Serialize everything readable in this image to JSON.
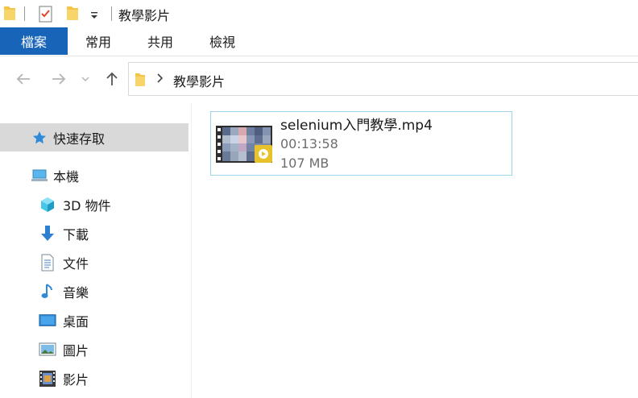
{
  "window": {
    "title": "教學影片"
  },
  "ribbon": {
    "tabs": [
      {
        "label": "檔案"
      },
      {
        "label": "常用"
      },
      {
        "label": "共用"
      },
      {
        "label": "檢視"
      }
    ]
  },
  "address": {
    "path": "教學影片"
  },
  "sidebar": {
    "items": [
      {
        "label": "快速存取",
        "icon": "star-icon"
      },
      {
        "label": "本機",
        "icon": "computer-icon"
      },
      {
        "label": "3D 物件",
        "icon": "3d-objects-icon"
      },
      {
        "label": "下載",
        "icon": "download-icon"
      },
      {
        "label": "文件",
        "icon": "document-icon"
      },
      {
        "label": "音樂",
        "icon": "music-icon"
      },
      {
        "label": "桌面",
        "icon": "desktop-icon"
      },
      {
        "label": "圖片",
        "icon": "pictures-icon"
      },
      {
        "label": "影片",
        "icon": "videos-icon"
      }
    ]
  },
  "content": {
    "files": [
      {
        "name": "selenium入門教學.mp4",
        "duration": "00:13:58",
        "size": "107 MB",
        "icon": "video-thumbnail"
      }
    ]
  },
  "colors": {
    "accent": "#1764b8",
    "selected_bg": "#d9d9d9",
    "tile_border": "#9fd4ea",
    "folder": "#f3c64a"
  }
}
